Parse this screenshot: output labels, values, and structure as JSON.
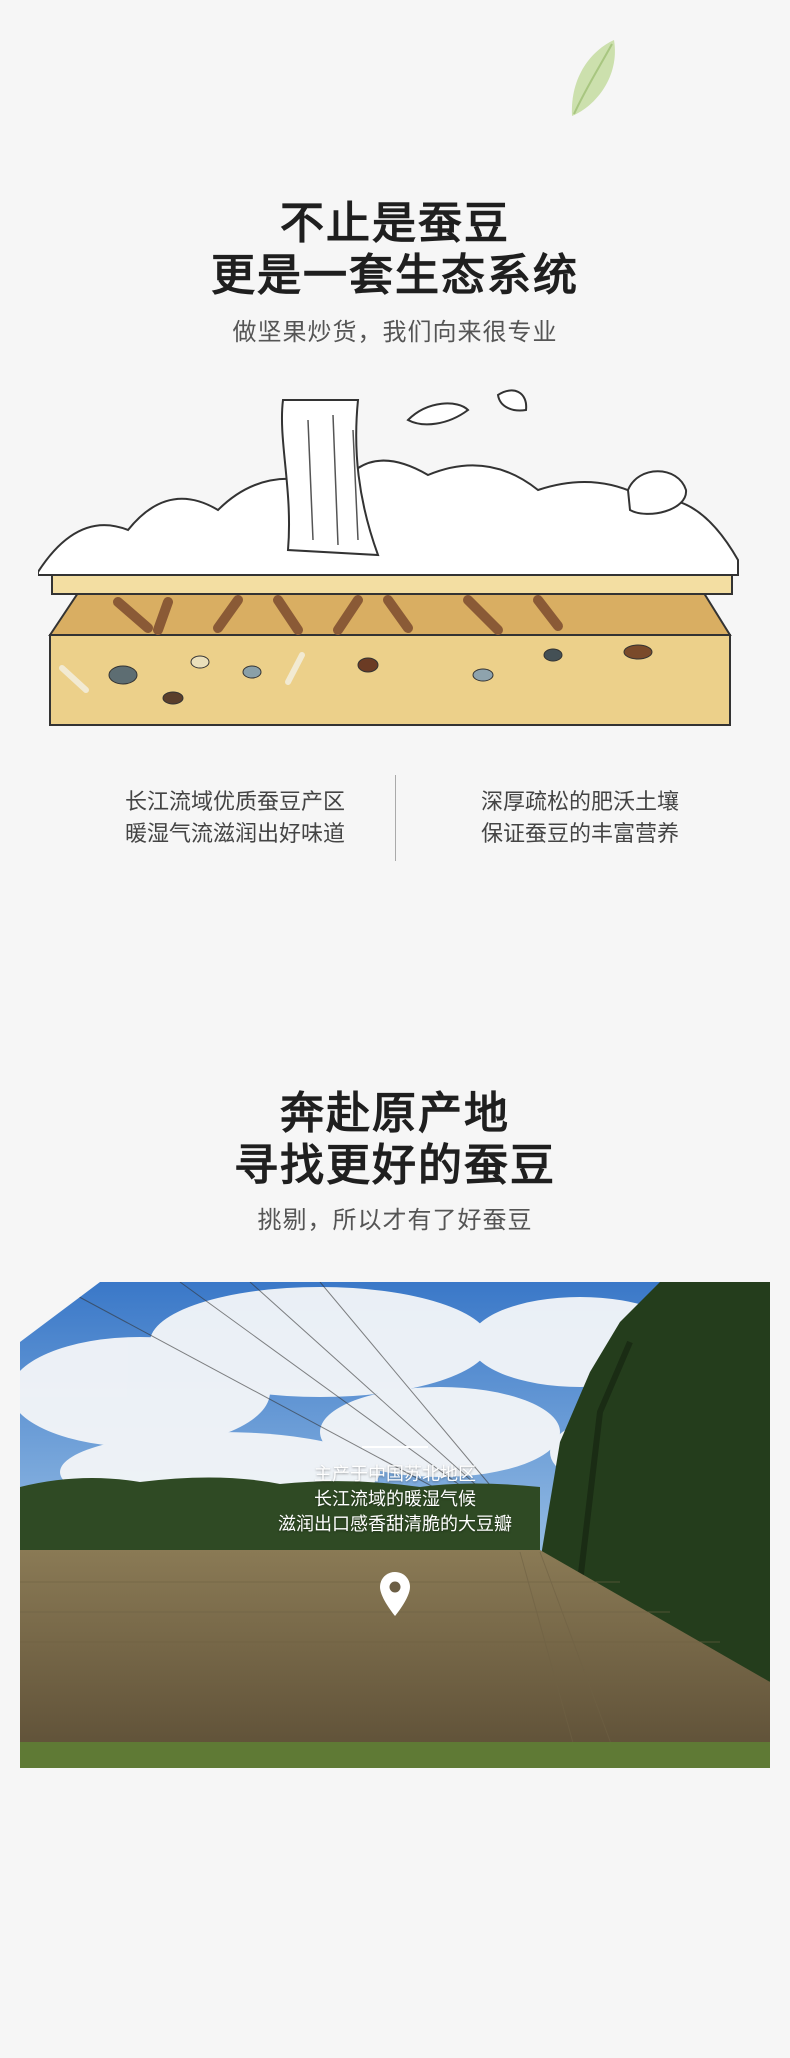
{
  "section1": {
    "title_line1": "不止是蚕豆",
    "title_line2": "更是一套生态系统",
    "subtitle": "做坚果炒货，我们向来很专业",
    "feature_left": [
      "长江流域优质蚕豆产区",
      "暖湿气流滋润出好味道"
    ],
    "feature_right": [
      "深厚疏松的肥沃土壤",
      "保证蚕豆的丰富营养"
    ]
  },
  "section2": {
    "title_line1": "奔赴原产地",
    "title_line2": "寻找更好的蚕豆",
    "subtitle": "挑剔，所以才有了好蚕豆",
    "photo_text": [
      "主产于中国苏北地区",
      "长江流域的暖湿气候",
      "滋润出口感香甜清脆的大豆瓣"
    ]
  },
  "icons": {
    "leaf": "leaf-icon",
    "pin": "location-pin-icon"
  },
  "colors": {
    "background": "#f6f6f6",
    "soil": "#e8c878",
    "leaf": "#b9d48a"
  }
}
